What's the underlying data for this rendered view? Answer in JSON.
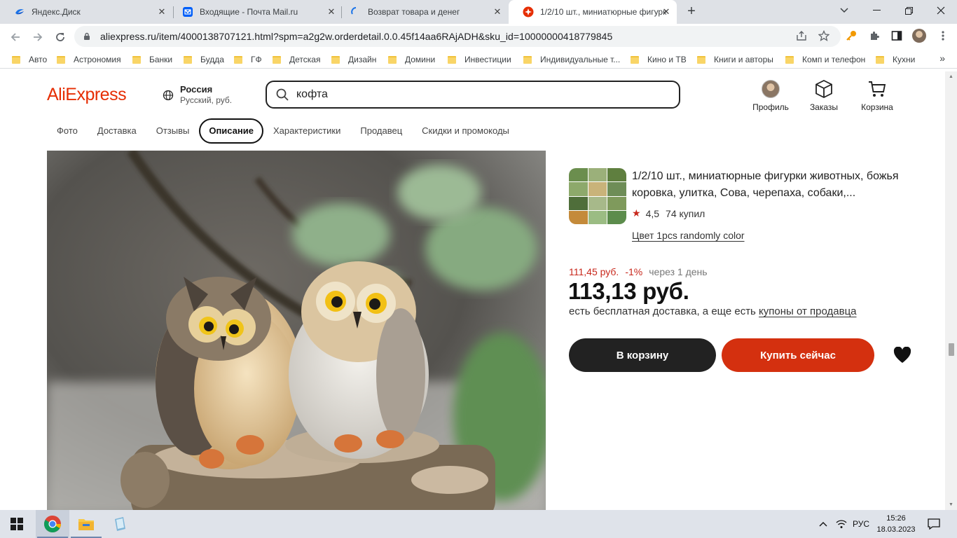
{
  "browser": {
    "tabs": [
      {
        "title": "Яндекс.Диск",
        "active": false
      },
      {
        "title": "Входящие - Почта Mail.ru",
        "active": false
      },
      {
        "title": "Возврат товара и денег",
        "active": false
      },
      {
        "title": "1/2/10 шт., миниатюрные фигурк",
        "active": true
      }
    ],
    "new_tab": "+",
    "url": "aliexpress.ru/item/4000138707121.html?spm=a2g2w.orderdetail.0.0.45f14aa6RAjADH&sku_id=10000000418779845",
    "bookmarks": [
      "Авто",
      "Астрономия",
      "Банки",
      "Будда",
      "ГФ",
      "Детская",
      "Дизайн",
      "Домини",
      "Инвестиции",
      "Индивидуальные т...",
      "Кино и ТВ",
      "Книги и авторы",
      "Комп и телефон",
      "Кухни"
    ],
    "bookmarks_more": "»",
    "colors": {
      "tabbar": "#dee1e6",
      "folder": "#f9d567"
    }
  },
  "header": {
    "logo": "AliExpress",
    "region_country": "Россия",
    "region_sub": "Русский, руб.",
    "search_value": "кофта",
    "actions": [
      {
        "label": "Профиль",
        "icon": "avatar"
      },
      {
        "label": "Заказы",
        "icon": "box-icon"
      },
      {
        "label": "Корзина",
        "icon": "cart-icon"
      }
    ],
    "colors": {
      "brand": "#e62e04"
    }
  },
  "section_tabs": [
    "Фото",
    "Доставка",
    "Отзывы",
    "Описание",
    "Характеристики",
    "Продавец",
    "Скидки и промокоды"
  ],
  "active_section_tab": "Описание",
  "product": {
    "title": "1/2/10 шт., миниатюрные фигурки животных, божья коровка, улитка, Сова, черепаха, собаки,...",
    "rating": "4,5",
    "sold": "74 купил",
    "variant": "Цвет 1pcs randomly color",
    "old_price": "111,45 руб.",
    "discount": "-1%",
    "price_change_note": "через 1 день",
    "price": "113,13 руб.",
    "shipping_text": "есть бесплатная доставка, а еще есть ",
    "shipping_link": "купоны от продавца",
    "add_to_cart": "В корзину",
    "buy_now": "Купить сейчас",
    "colors": {
      "accent": "#d4300f",
      "dark_button": "#222222",
      "price_red": "#c8281c"
    }
  },
  "taskbar": {
    "language": "РУС",
    "time": "15:26",
    "date": "18.03.2023"
  }
}
